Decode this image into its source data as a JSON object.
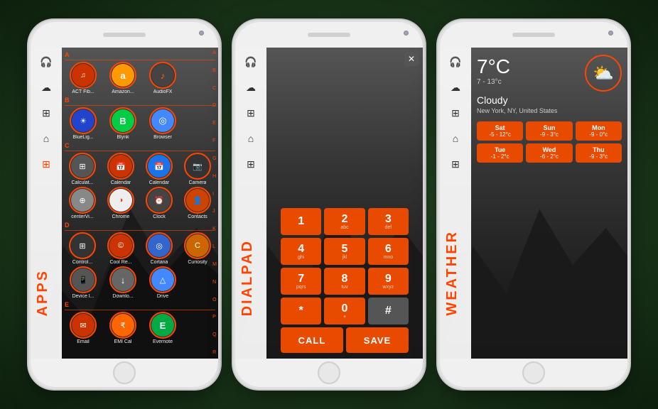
{
  "phones": {
    "phone1": {
      "label": "APPS",
      "alphabet": [
        "A",
        "B",
        "C",
        "D",
        "E",
        "F",
        "G",
        "H",
        "I",
        "J",
        "K",
        "L",
        "M",
        "N",
        "O",
        "P",
        "Q",
        "R"
      ],
      "sections": [
        {
          "letter": "A",
          "apps": [
            {
              "name": "ACT Fib...",
              "icon": "actfib",
              "symbol": "♫"
            },
            {
              "name": "Amazon...",
              "icon": "amazon",
              "symbol": "a"
            },
            {
              "name": "AudioFX",
              "icon": "audiofx",
              "symbol": "♪"
            }
          ]
        },
        {
          "letter": "B",
          "apps": [
            {
              "name": "BlueLig...",
              "icon": "bluelight",
              "symbol": "☀"
            },
            {
              "name": "Blynk",
              "icon": "blynk",
              "symbol": "B"
            },
            {
              "name": "Browser",
              "icon": "browser",
              "symbol": "◎"
            }
          ]
        },
        {
          "letter": "C",
          "apps": [
            {
              "name": "Calculat...",
              "icon": "calculator",
              "symbol": "⊞"
            },
            {
              "name": "Calendar",
              "icon": "calendar",
              "symbol": "📅"
            },
            {
              "name": "Calendar",
              "icon": "calendar2",
              "symbol": "📅"
            },
            {
              "name": "Camera",
              "icon": "camera",
              "symbol": "📷"
            }
          ]
        },
        {
          "letter": "",
          "apps": [
            {
              "name": "centerVi...",
              "icon": "centerview",
              "symbol": "⊕"
            },
            {
              "name": "Chrome",
              "icon": "chrome",
              "symbol": "◑"
            },
            {
              "name": "Clock",
              "icon": "clock",
              "symbol": "⏰"
            },
            {
              "name": "Contacts",
              "icon": "contacts",
              "symbol": "👤"
            }
          ]
        },
        {
          "letter": "D",
          "apps": [
            {
              "name": "Control...",
              "icon": "controlr",
              "symbol": "⊞"
            },
            {
              "name": "Cool Re...",
              "icon": "coolre",
              "symbol": "©"
            },
            {
              "name": "Cortana",
              "icon": "cortana",
              "symbol": "◎"
            },
            {
              "name": "Curiosity",
              "icon": "curiosity",
              "symbol": "C"
            }
          ]
        },
        {
          "letter": "",
          "apps": [
            {
              "name": "Device I...",
              "icon": "deviceid",
              "symbol": "📱"
            },
            {
              "name": "Downlo...",
              "icon": "downloads",
              "symbol": "↓"
            },
            {
              "name": "Drive",
              "icon": "drive",
              "symbol": "△"
            }
          ]
        },
        {
          "letter": "E",
          "apps": [
            {
              "name": "Email",
              "icon": "email",
              "symbol": "✉"
            },
            {
              "name": "EMI Cal",
              "icon": "emical",
              "symbol": "₹"
            },
            {
              "name": "Evernote",
              "icon": "evernote",
              "symbol": "E"
            }
          ]
        }
      ]
    },
    "phone2": {
      "label": "DIALPAD",
      "keys": [
        {
          "num": "1",
          "sub": ""
        },
        {
          "num": "2",
          "sub": "abc"
        },
        {
          "num": "3",
          "sub": "def"
        },
        {
          "num": "4",
          "sub": "ghi"
        },
        {
          "num": "5",
          "sub": "jkl"
        },
        {
          "num": "6",
          "sub": "mno"
        },
        {
          "num": "7",
          "sub": "pqrs"
        },
        {
          "num": "8",
          "sub": "tuv"
        },
        {
          "num": "9",
          "sub": "wxyz"
        },
        {
          "num": "*",
          "sub": ""
        },
        {
          "num": "0",
          "sub": "+"
        },
        {
          "num": "#",
          "sub": ""
        }
      ],
      "call_label": "CALL",
      "save_label": "SAVE"
    },
    "phone3": {
      "label": "WEATHER",
      "temp": "7°C",
      "range": "7 - 13°c",
      "condition": "Cloudy",
      "location": "New York, NY, United States",
      "days": [
        {
          "name": "Sat",
          "temp": "-5 - 12°c"
        },
        {
          "name": "Sun",
          "temp": "-9 - 3°c"
        },
        {
          "name": "Mon",
          "temp": "-9 - 0°c"
        },
        {
          "name": "Tue",
          "temp": "-1 - 2°c"
        },
        {
          "name": "Wed",
          "temp": "-6 - 2°c"
        },
        {
          "name": "Thu",
          "temp": "-9 - 3°c"
        }
      ]
    }
  },
  "sidebar": {
    "icons": [
      {
        "name": "headphone-icon",
        "symbol": "🎧"
      },
      {
        "name": "cloud-icon",
        "symbol": "☁"
      },
      {
        "name": "grid-icon",
        "symbol": "⊞"
      },
      {
        "name": "home-icon",
        "symbol": "⌂"
      },
      {
        "name": "apps-icon",
        "symbol": "⊞"
      }
    ]
  }
}
